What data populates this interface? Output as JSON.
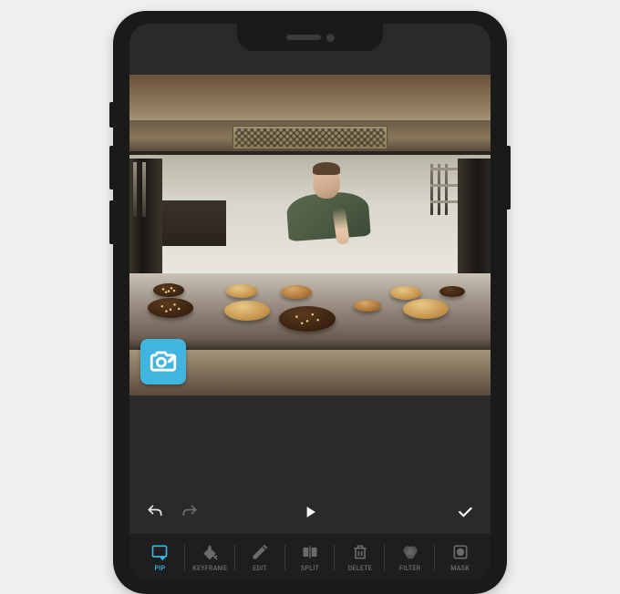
{
  "app": {
    "accent_color": "#3fb5e0",
    "bg_dark": "#2a2a2c"
  },
  "preview": {
    "watermark_icon": "camera-eraser-icon"
  },
  "player": {
    "undo": "undo-icon",
    "redo": "redo-icon",
    "play": "play-icon",
    "confirm": "check-icon"
  },
  "tabs": [
    {
      "id": "pip",
      "label": "PIP",
      "active": true
    },
    {
      "id": "keyframe",
      "label": "KEYFRAME",
      "active": false
    },
    {
      "id": "edit",
      "label": "EDIT",
      "active": false
    },
    {
      "id": "split",
      "label": "SPLIT",
      "active": false
    },
    {
      "id": "delete",
      "label": "DELETE",
      "active": false
    },
    {
      "id": "filter",
      "label": "FILTER",
      "active": false
    },
    {
      "id": "mask",
      "label": "MASK",
      "active": false
    }
  ]
}
